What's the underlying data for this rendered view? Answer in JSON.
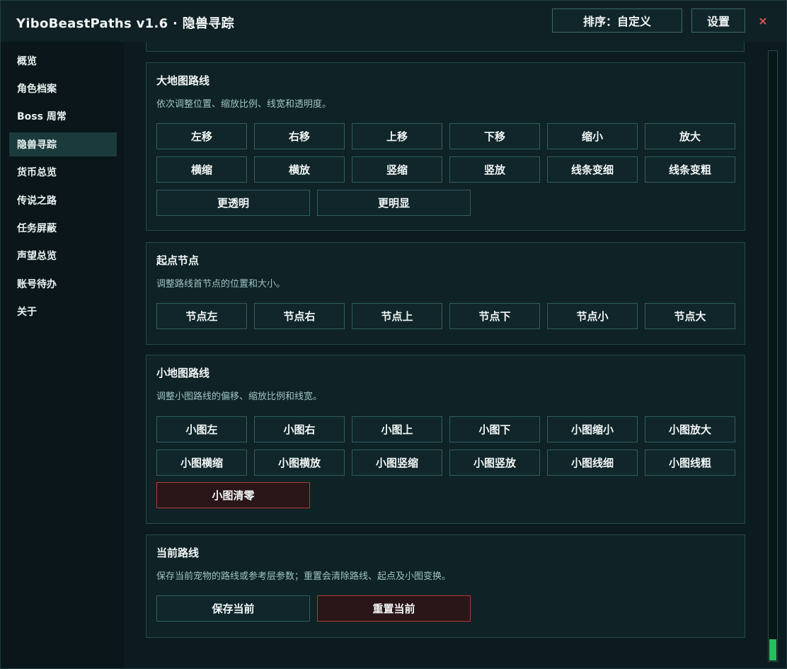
{
  "app": {
    "title": "YiboBeastPaths v1.6 · 隐兽寻踪",
    "sort_label": "排序：自定义",
    "settings_label": "设置",
    "close_symbol": "×"
  },
  "sidebar": {
    "items": [
      {
        "label": "概览",
        "active": false
      },
      {
        "label": "角色档案",
        "active": false
      },
      {
        "label": "Boss 周常",
        "active": false
      },
      {
        "label": "隐兽寻踪",
        "active": true
      },
      {
        "label": "货币总览",
        "active": false
      },
      {
        "label": "传说之路",
        "active": false
      },
      {
        "label": "任务屏蔽",
        "active": false
      },
      {
        "label": "声望总览",
        "active": false
      },
      {
        "label": "账号待办",
        "active": false
      },
      {
        "label": "关于",
        "active": false
      }
    ]
  },
  "sections": {
    "world_map": {
      "title": "大地图路线",
      "desc": "依次调整位置、缩放比例、线宽和透明度。",
      "buttons": [
        "左移",
        "右移",
        "上移",
        "下移",
        "缩小",
        "放大",
        "横缩",
        "横放",
        "竖缩",
        "竖放",
        "线条变细",
        "线条变粗",
        "更透明",
        "更明显"
      ]
    },
    "start_node": {
      "title": "起点节点",
      "desc": "调整路线首节点的位置和大小。",
      "buttons": [
        "节点左",
        "节点右",
        "节点上",
        "节点下",
        "节点小",
        "节点大"
      ]
    },
    "mini_map": {
      "title": "小地图路线",
      "desc": "调整小图路线的偏移、缩放比例和线宽。",
      "buttons": [
        "小图左",
        "小图右",
        "小图上",
        "小图下",
        "小图缩小",
        "小图放大",
        "小图横缩",
        "小图横放",
        "小图竖缩",
        "小图竖放",
        "小图线细",
        "小图线粗"
      ],
      "reset_label": "小图清零"
    },
    "current_route": {
      "title": "当前路线",
      "desc": "保存当前宠物的路线或参考层参数；重置会清除路线、起点及小图变换。",
      "save_label": "保存当前",
      "reset_label": "重置当前"
    }
  },
  "colors": {
    "accent": "#25c05a",
    "danger": "#b33a3a",
    "close": "#e05555"
  }
}
